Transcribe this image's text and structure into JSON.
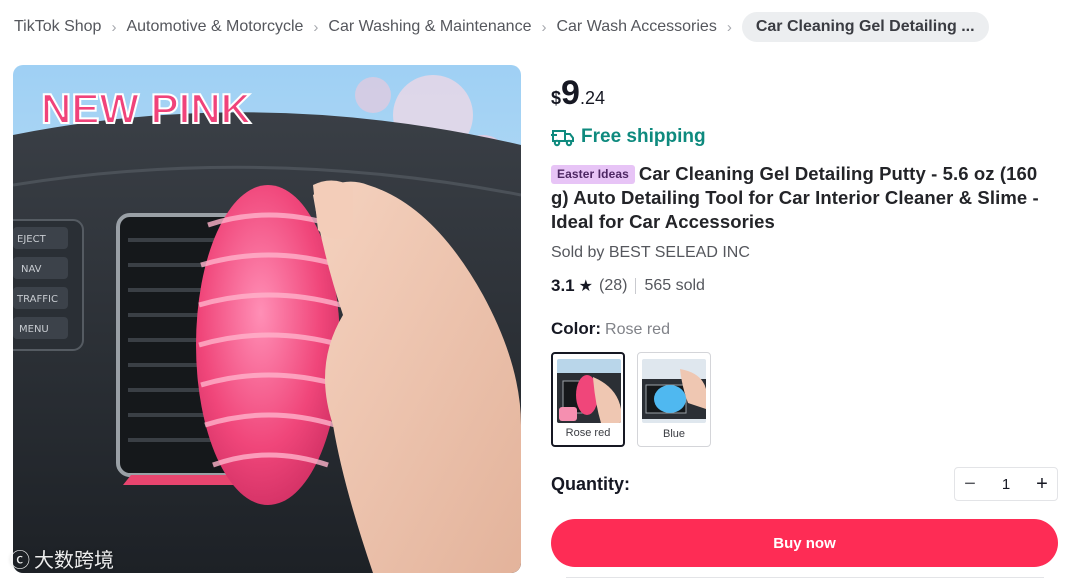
{
  "breadcrumb": {
    "items": [
      "TikTok Shop",
      "Automotive & Motorcycle",
      "Car Washing & Maintenance",
      "Car Wash Accessories"
    ],
    "current": "Car Cleaning Gel Detailing ..."
  },
  "image": {
    "banner_text": "NEW PINK",
    "dash_buttons": [
      "EJECT",
      "NAV",
      "TRAFFIC",
      "MENU"
    ],
    "watermark_text": "大数跨境"
  },
  "price": {
    "currency": "$",
    "integer": "9",
    "decimal": ".24"
  },
  "shipping": {
    "label": "Free shipping",
    "icon": "truck-icon"
  },
  "title": {
    "badge": "Easter Ideas",
    "text": "Car Cleaning Gel Detailing Putty - 5.6 oz (160 g) Auto Detailing Tool for Car Interior Cleaner & Slime - Ideal for Car Accessories"
  },
  "seller": "Sold by BEST SELEAD INC",
  "rating": {
    "score": "3.1",
    "reviews": "(28)",
    "sold": "565 sold"
  },
  "color": {
    "label": "Color:",
    "selected": "Rose red",
    "options": [
      {
        "name": "Rose red",
        "swatch": "#f04a78"
      },
      {
        "name": "Blue",
        "swatch": "#4fb8f0"
      }
    ]
  },
  "quantity": {
    "label": "Quantity:",
    "value": "1",
    "minus": "−",
    "plus": "+"
  },
  "buy_button": "Buy now",
  "colors": {
    "accent": "#fe2c55",
    "shipping": "#0e8a7e",
    "badge_bg": "#e7c4f6"
  }
}
